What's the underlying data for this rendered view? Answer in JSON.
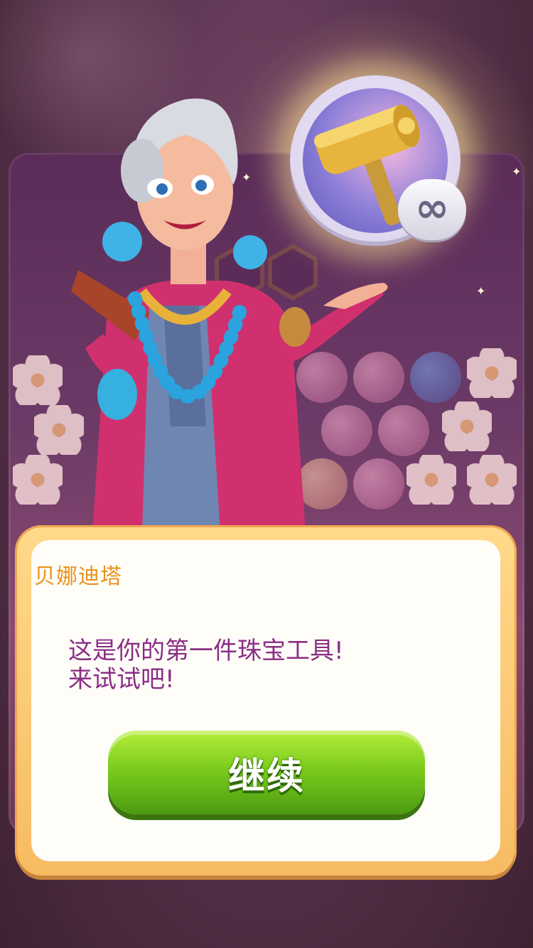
{
  "reward": {
    "item_icon": "hammer-icon",
    "quantity_symbol": "∞"
  },
  "dialog": {
    "speaker": "贝娜迪塔",
    "message_lines": [
      "这是你的第一件珠宝工具!",
      "来试试吧!"
    ],
    "continue_label": "继续"
  },
  "colors": {
    "speaker": "#e8931a",
    "message": "#8a2e86",
    "button_green": "#7ccc1e",
    "dialog_frame": "#f7bb62"
  }
}
